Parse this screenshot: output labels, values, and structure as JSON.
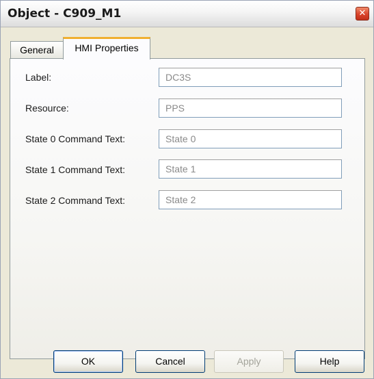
{
  "window": {
    "title": "Object - C909_M1",
    "close_glyph": "✕"
  },
  "tabs": [
    {
      "label": "General",
      "active": false
    },
    {
      "label": "HMI Properties",
      "active": true
    }
  ],
  "fields": [
    {
      "label": "Label:",
      "value": "DC3S"
    },
    {
      "label": "Resource:",
      "value": "PPS"
    },
    {
      "label": "State 0 Command Text:",
      "value": "State 0"
    },
    {
      "label": "State 1 Command Text:",
      "value": "State 1"
    },
    {
      "label": "State 2 Command Text:",
      "value": "State 2"
    }
  ],
  "buttons": {
    "ok": "OK",
    "cancel": "Cancel",
    "apply": "Apply",
    "help": "Help"
  },
  "colors": {
    "active_tab_accent": "#f0b030",
    "close_button": "#d9432a"
  }
}
